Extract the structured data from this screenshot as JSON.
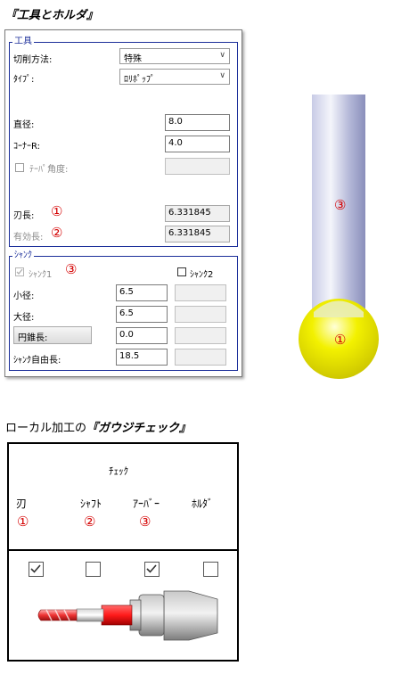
{
  "section1_title": "『工具とホルダ』",
  "tool_group": {
    "title": "工具",
    "cut_method_label": "切削方法:",
    "cut_method_value": "特殊",
    "type_label": "ﾀｲﾌﾟ:",
    "type_value": "ﾛﾘﾎﾟｯﾌﾟ",
    "diameter_label": "直径:",
    "diameter_value": "8.0",
    "corner_r_label": "ｺｰﾅｰR:",
    "corner_r_value": "4.0",
    "taper_label": "ﾃｰﾊﾟ角度:",
    "taper_value": "",
    "blade_length_label": "刃長:",
    "blade_length_value": "6.331845",
    "blade_marker": "①",
    "effective_length_label": "有効長:",
    "effective_length_value": "6.331845",
    "effective_marker": "②"
  },
  "shank_group": {
    "title": "ｼｬﾝｸ",
    "shank1_label": "ｼｬﾝｸ1",
    "shank1_marker": "③",
    "shank2_label": "ｼｬﾝｸ2",
    "rows": [
      {
        "label": "小径:",
        "value": "6.5",
        "extra": ""
      },
      {
        "label": "大径:",
        "value": "6.5",
        "extra": ""
      },
      {
        "label": "円錐長:",
        "value": "0.0",
        "extra": ""
      },
      {
        "label": "ｼｬﾝｸ自由長:",
        "value": "18.5",
        "extra": ""
      }
    ]
  },
  "tool_illustration": {
    "shank_marker": "③",
    "ball_marker": "①"
  },
  "section2_title_plain": "ローカル加工の",
  "section2_title_bold": "『ガウジチェック』",
  "gouge_check": {
    "header": "ﾁｪｯｸ",
    "columns": [
      {
        "label": "刃",
        "marker": "①",
        "checked": true
      },
      {
        "label": "ｼｬﾌﾄ",
        "marker": "②",
        "checked": false
      },
      {
        "label": "ｱｰﾊﾞｰ",
        "marker": "③",
        "checked": true
      },
      {
        "label": "ﾎﾙﾀﾞ",
        "marker": "",
        "checked": false
      }
    ]
  }
}
